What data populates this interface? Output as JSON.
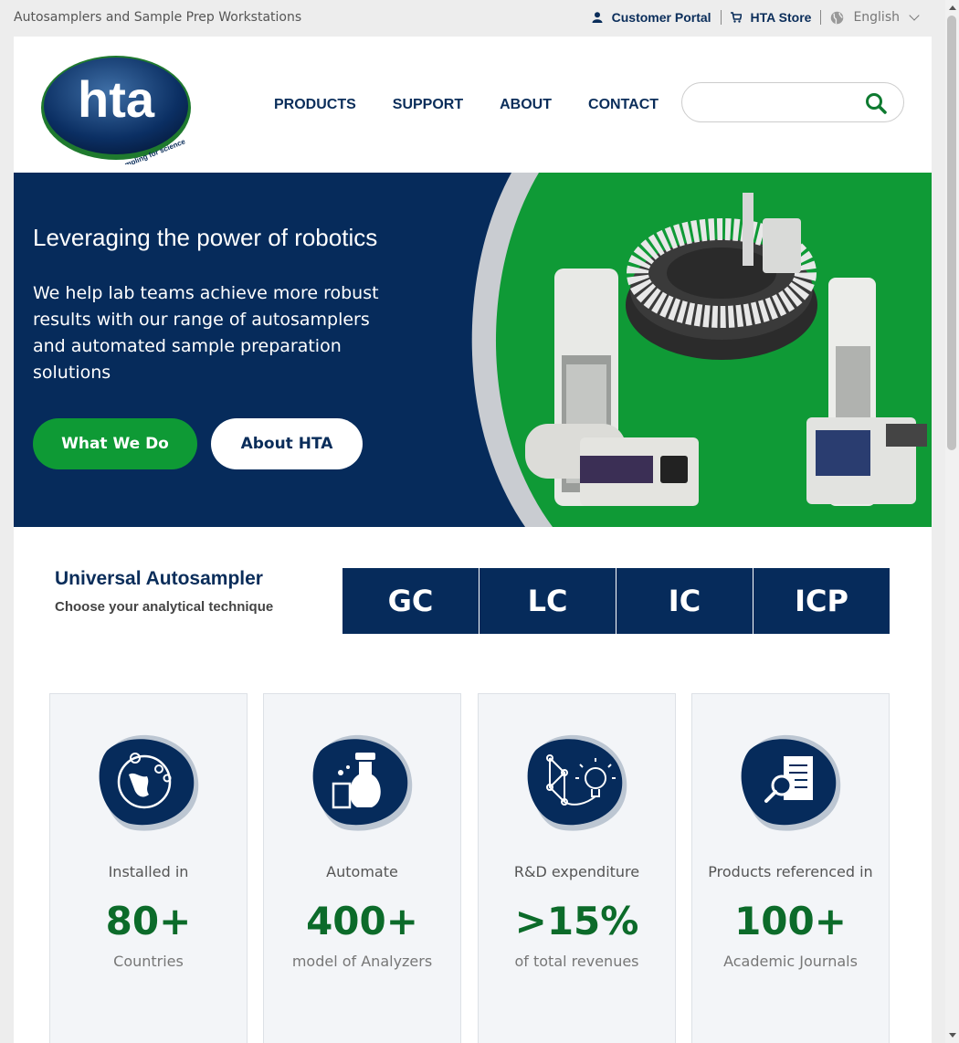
{
  "topbar": {
    "tagline": "Autosamplers and Sample Prep Workstations",
    "customer_portal": "Customer Portal",
    "store": "HTA Store",
    "language": "English"
  },
  "logo": {
    "text": "hta",
    "tagline": "sampling for science"
  },
  "nav": {
    "items": [
      "PRODUCTS",
      "SUPPORT",
      "ABOUT",
      "CONTACT"
    ]
  },
  "search": {
    "placeholder": ""
  },
  "hero": {
    "title": "Leveraging the power of robotics",
    "text": "We help lab teams achieve more robust results with our range of autosamplers and automated sample preparation solutions",
    "btn_primary": "What We Do",
    "btn_secondary": "About HTA"
  },
  "universal": {
    "title": "Universal Autosampler",
    "subtitle": "Choose your analytical technique",
    "techniques": [
      "GC",
      "LC",
      "IC",
      "ICP"
    ]
  },
  "stats": [
    {
      "pre": "Installed in",
      "number": "80+",
      "post": "Countries",
      "icon": "globe-pin-icon"
    },
    {
      "pre": "Automate",
      "number": "400+",
      "post": "model of Analyzers",
      "icon": "lab-flask-icon"
    },
    {
      "pre": "R&D expenditure",
      "number": ">15%",
      "post": "of total revenues",
      "icon": "innovation-bulb-icon"
    },
    {
      "pre": "Products referenced in",
      "number": "100+",
      "post": "Academic Journals",
      "icon": "document-search-icon"
    }
  ],
  "colors": {
    "navy": "#062b5b",
    "green": "#0e9a35",
    "stat_number": "#0c6b2a"
  }
}
